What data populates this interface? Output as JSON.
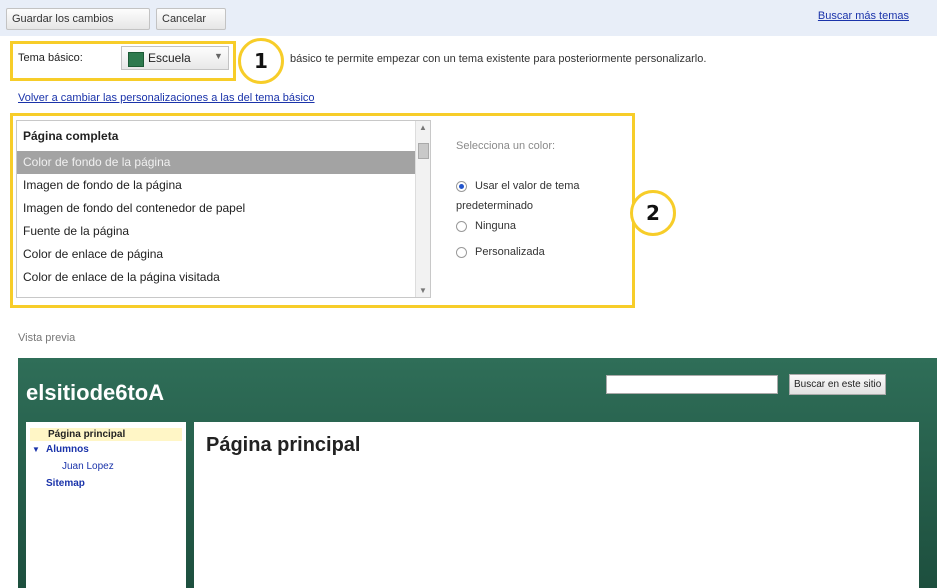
{
  "toolbar": {
    "save_label": "Guardar los cambios",
    "cancel_label": "Cancelar",
    "more_themes_link": "Buscar más temas"
  },
  "theme": {
    "label": "Tema básico:",
    "selected": "Escuela",
    "description": "básico te permite empezar con un tema existente para posteriormente personalizarlo."
  },
  "revert_link": "Volver a cambiar las personalizaciones a las del tema básico",
  "properties": {
    "header": "Página completa",
    "items": [
      "Color de fondo de la página",
      "Imagen de fondo de la página",
      "Imagen de fondo del contenedor de papel",
      "Fuente de la página",
      "Color de enlace de página",
      "Color de enlace de la página visitada"
    ],
    "selected_index": 0
  },
  "color_picker": {
    "title": "Selecciona un color:",
    "options": [
      "Usar el valor de tema predeterminado",
      "Ninguna",
      "Personalizada"
    ],
    "selected_index": 0
  },
  "callouts": [
    "1",
    "2"
  ],
  "preview": {
    "label": "Vista previa",
    "site_title": "elsitiode6toA",
    "search_button": "Buscar en este sitio",
    "nav": [
      "Página principal",
      "Alumnos",
      "Juan Lopez",
      "Sitemap"
    ],
    "page_title": "Página principal"
  },
  "colors": {
    "highlight": "#f7cd29",
    "preview_bg": "#2f6e58",
    "link": "#1a33aa"
  }
}
